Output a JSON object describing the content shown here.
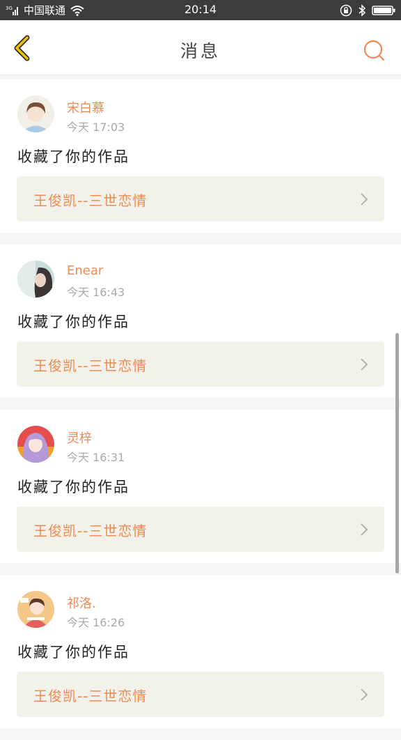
{
  "status_bar": {
    "carrier": "中国联通",
    "time": "20:14",
    "network": "3G"
  },
  "header": {
    "title": "消息"
  },
  "messages": [
    {
      "username": "宋白慕",
      "timestamp": "今天 17:03",
      "action": "收藏了你的作品",
      "work_title": "王俊凯--三世恋情",
      "avatar": "boy-illustration-avatar"
    },
    {
      "username": "Enear",
      "timestamp": "今天 16:43",
      "action": "收藏了你的作品",
      "work_title": "王俊凯--三世恋情",
      "avatar": "girl-photo-avatar"
    },
    {
      "username": "灵梓",
      "timestamp": "今天 16:31",
      "action": "收藏了你的作品",
      "work_title": "王俊凯--三世恋情",
      "avatar": "anime-girl-avatar"
    },
    {
      "username": "祁洛.",
      "timestamp": "今天 16:26",
      "action": "收藏了你的作品",
      "work_title": "王俊凯--三世恋情",
      "avatar": "cartoon-boy-avatar"
    }
  ],
  "colors": {
    "accent": "#ee8a55",
    "back_icon": "#f2c200",
    "link_background": "#f3f2ea",
    "status_bar": "#3c3c3c"
  }
}
